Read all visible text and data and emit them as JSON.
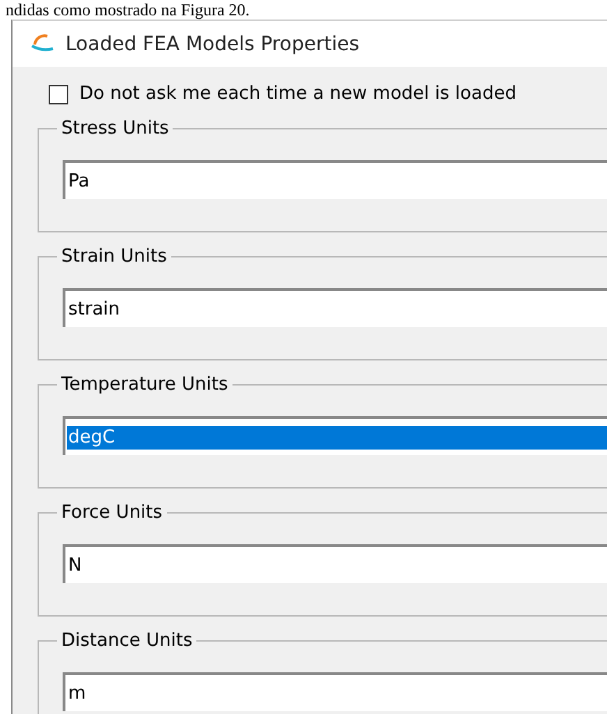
{
  "document_text": "ndidas como mostrado na Figura 20.",
  "window": {
    "title": "Loaded FEA Models Properties"
  },
  "ask_checkbox": {
    "label": "Do not ask me each time a new model is loaded",
    "checked": false
  },
  "groups": [
    {
      "title": "Stress Units",
      "value": "Pa",
      "selected": false
    },
    {
      "title": "Strain Units",
      "value": "strain",
      "selected": false
    },
    {
      "title": "Temperature Units",
      "value": "degC",
      "selected": true
    },
    {
      "title": "Force Units",
      "value": "N",
      "selected": false
    },
    {
      "title": "Distance Units",
      "value": "m",
      "selected": false
    }
  ]
}
